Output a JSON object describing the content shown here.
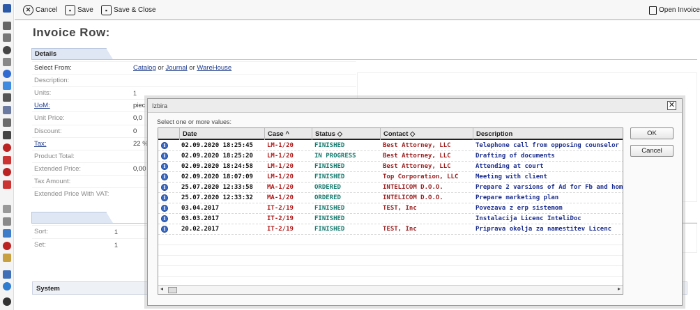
{
  "toolbar": {
    "cancel_label": "Cancel",
    "save_label": "Save",
    "save_close_label": "Save & Close",
    "open_invoice_label": "Open Invoice"
  },
  "page": {
    "title": "Invoice Row:"
  },
  "details": {
    "tab_label": "Details",
    "select_from": {
      "label": "Select From:",
      "catalog": "Catalog",
      "or1": "or",
      "journal": "Journal",
      "or2": "or",
      "warehouse": "WareHouse"
    },
    "fields": [
      {
        "label": "Description:",
        "value": ""
      },
      {
        "label": "Units:",
        "value": "1"
      },
      {
        "label": "UoM:",
        "value": "piec"
      },
      {
        "label": "Unit Price:",
        "value": "0,0"
      },
      {
        "label": "Discount:",
        "value": "0"
      },
      {
        "label": "Tax:",
        "value": "22 %"
      },
      {
        "label": "Product Total:",
        "value": ""
      },
      {
        "label": "Extended Price:",
        "value": "0,00"
      },
      {
        "label": "Tax Amount:",
        "value": ""
      },
      {
        "label": "Extended Price With VAT:",
        "value": ""
      }
    ]
  },
  "second_section": {
    "fields": [
      {
        "label": "Sort:",
        "value": "1"
      },
      {
        "label": "Set:",
        "value": "1"
      }
    ]
  },
  "system": {
    "tab_label": "System"
  },
  "dialog": {
    "title": "Izbira",
    "subtitle": "Select one or more values:",
    "ok_label": "OK",
    "cancel_label": "Cancel",
    "columns": {
      "date": "Date",
      "case": "Case",
      "case_sort": "^",
      "status": "Status",
      "status_sort": "◇",
      "contact": "Contact",
      "contact_sort": "◇",
      "description": "Description"
    },
    "rows": [
      {
        "date": "02.09.2020 18:25:45",
        "case": "LM-1/20",
        "status": "FINISHED",
        "contact": "Best Attorney, LLC",
        "description": "Telephone call from opposing counselor"
      },
      {
        "date": "02.09.2020 18:25:20",
        "case": "LM-1/20",
        "status": "IN PROGRESS",
        "contact": "Best Attorney, LLC",
        "description": "Drafting of documents"
      },
      {
        "date": "02.09.2020 18:24:58",
        "case": "LM-1/20",
        "status": "FINISHED",
        "contact": "Best Attorney, LLC",
        "description": "Attending at court"
      },
      {
        "date": "02.09.2020 18:07:09",
        "case": "LM-1/20",
        "status": "FINISHED",
        "contact": "Top Corporation, LLC",
        "description": "Meeting with client"
      },
      {
        "date": "25.07.2020 12:33:58",
        "case": "MA-1/20",
        "status": "ORDERED",
        "contact": "INTELICOM D.O.O.",
        "description": "Prepare 2 varsions of Ad for Fb and hom"
      },
      {
        "date": "25.07.2020 12:33:32",
        "case": "MA-1/20",
        "status": "ORDERED",
        "contact": "INTELICOM D.O.O.",
        "description": "Prepare marketing plan"
      },
      {
        "date": "03.04.2017",
        "case": "IT-2/19",
        "status": "FINISHED",
        "contact": "TEST, Inc",
        "description": "Povezava z erp sistemom"
      },
      {
        "date": "03.03.2017",
        "case": "IT-2/19",
        "status": "FINISHED",
        "contact": "",
        "description": "Instalacija Licenc InteliDoc"
      },
      {
        "date": "20.02.2017",
        "case": "IT-2/19",
        "status": "FINISHED",
        "contact": "TEST, Inc",
        "description": "Priprava okolja za namestitev Licenc"
      }
    ]
  },
  "colors": {
    "case": "#b01818",
    "status": "#157a6e",
    "contact": "#9b1d1d",
    "description": "#1c2f8f",
    "date": "#111111"
  }
}
